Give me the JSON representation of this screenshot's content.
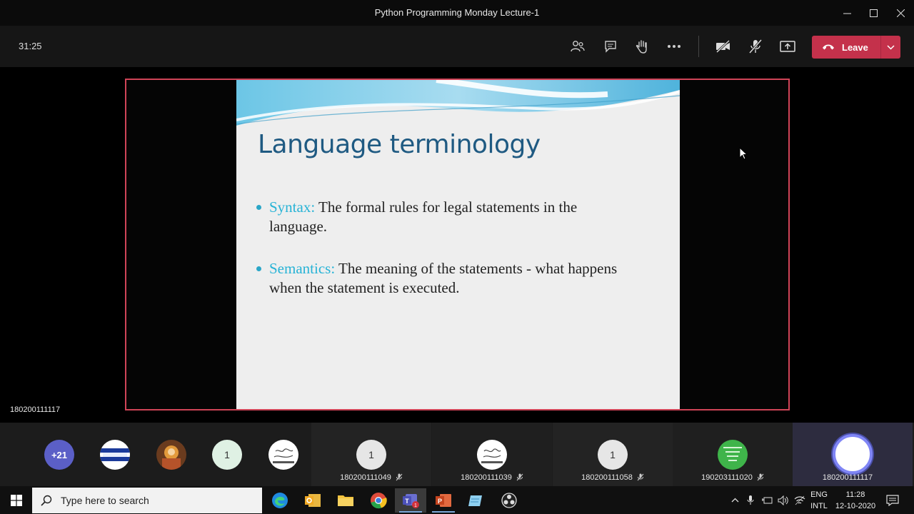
{
  "window": {
    "title": "Python Programming Monday Lecture-1"
  },
  "toolbar": {
    "timer": "31:25",
    "leave_label": "Leave"
  },
  "slide": {
    "title": "Language terminology",
    "bullets": [
      {
        "term": "Syntax:",
        "text": " The formal rules for legal statements in the language."
      },
      {
        "term": "Semantics:",
        "text": " The meaning of the statements - what happens when the statement is executed."
      }
    ]
  },
  "presenter": {
    "name": "180200111117"
  },
  "participants": {
    "overflow": "+21",
    "avatars": [
      "",
      "",
      "1",
      ""
    ],
    "tiles": [
      {
        "avatar": "1",
        "name": "180200111049"
      },
      {
        "avatar": "",
        "name": "180200111039"
      },
      {
        "avatar": "1",
        "name": "180200111058"
      },
      {
        "avatar": "",
        "name": "190203111020"
      },
      {
        "avatar": "",
        "name": "180200111117"
      }
    ]
  },
  "taskbar": {
    "search_placeholder": "Type here to search",
    "lang_top": "ENG",
    "lang_bottom": "INTL",
    "time": "11:28",
    "date": "12-10-2020"
  },
  "colors": {
    "leave": "#c4314b",
    "accent_title": "#1f5a82",
    "term": "#27b3d6",
    "share_border": "#d04457"
  }
}
